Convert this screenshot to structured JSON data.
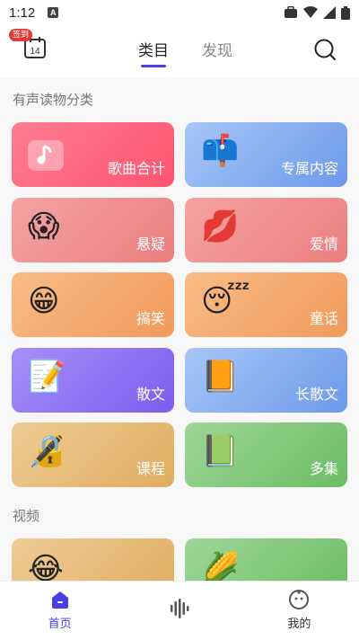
{
  "status_bar": {
    "time": "1:12",
    "indicator": "A"
  },
  "header": {
    "checkin_badge": "签到",
    "calendar_day": "14",
    "tabs": [
      {
        "label": "类目"
      },
      {
        "label": "发现"
      }
    ],
    "active_tab": "类目",
    "accent": "#4a3fe6"
  },
  "sections": {
    "audio_title": "有声读物分类",
    "video_title": "视频"
  },
  "cards": [
    {
      "label": "歌曲合计",
      "icon": "music-note-icon",
      "color": "#ff5f7c"
    },
    {
      "label": "专属内容",
      "icon": "mailbox-icon",
      "color": "#6d99ea"
    },
    {
      "label": "悬疑",
      "icon": "screaming-face-icon",
      "color": "#ee8a8a"
    },
    {
      "label": "爱情",
      "icon": "kiss-mark-icon",
      "color": "#ef8686"
    },
    {
      "label": "搞笑",
      "icon": "grinning-face-icon",
      "color": "#f2a063"
    },
    {
      "label": "童话",
      "icon": "sleeping-face-icon",
      "color": "#f2a063"
    },
    {
      "label": "散文",
      "icon": "memo-icon",
      "color": "#8a70f3"
    },
    {
      "label": "长散文",
      "icon": "orange-book-icon",
      "color": "#7aa6ea"
    },
    {
      "label": "课程",
      "icon": "locked-pen-icon",
      "color": "#e3b46d"
    },
    {
      "label": "多集",
      "icon": "green-book-icon",
      "color": "#7cc476"
    }
  ],
  "video_cards": [
    {
      "icon": "tears-of-joy-icon",
      "color": "#e3b46d"
    },
    {
      "icon": "corn-icon",
      "color": "#7cc476"
    }
  ],
  "bottom_nav": [
    {
      "label": "首页",
      "icon": "home-icon",
      "active": true
    },
    {
      "label": "",
      "icon": "sound-wave-icon",
      "active": false
    },
    {
      "label": "我的",
      "icon": "profile-face-icon",
      "active": false
    }
  ]
}
